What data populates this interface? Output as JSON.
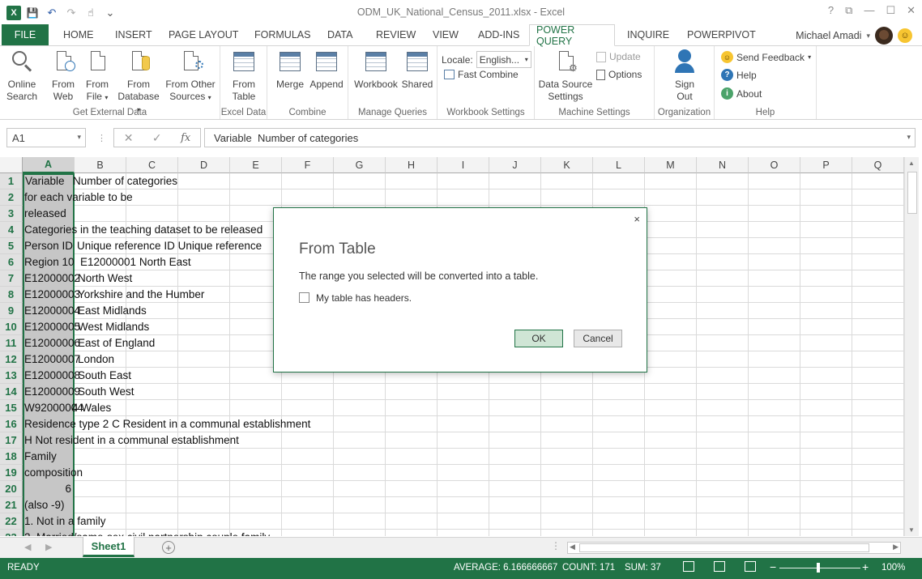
{
  "window": {
    "title": "ODM_UK_National_Census_2011.xlsx - Excel",
    "help_glyph": "?",
    "restore_glyph": "⧉",
    "minimize_glyph": "—",
    "maximize_glyph": "☐",
    "close_glyph": "✕"
  },
  "qat": {
    "logo": "X",
    "save_glyph": "💾",
    "undo_glyph": "↶",
    "redo_glyph": "↷",
    "touch_glyph": "☝",
    "more_glyph": "⌄"
  },
  "tabs": {
    "file": "FILE",
    "items": [
      "HOME",
      "INSERT",
      "PAGE LAYOUT",
      "FORMULAS",
      "DATA",
      "REVIEW",
      "VIEW",
      "ADD-INS",
      "POWER QUERY",
      "INQUIRE",
      "POWERPIVOT"
    ],
    "active": "POWER QUERY"
  },
  "user": {
    "name": "Michael Amadi",
    "dropdown": "▾",
    "smiley": "☺"
  },
  "ribbon": {
    "get_external_data": {
      "label": "Get External Data",
      "online_search": [
        "Online",
        "Search"
      ],
      "from_web": [
        "From",
        "Web"
      ],
      "from_file": [
        "From",
        "File"
      ],
      "from_database": [
        "From",
        "Database"
      ],
      "from_other": [
        "From Other",
        "Sources"
      ]
    },
    "excel_data": {
      "label": "Excel Data",
      "from_table": [
        "From",
        "Table"
      ]
    },
    "combine": {
      "label": "Combine",
      "merge": "Merge",
      "append": "Append"
    },
    "manage_queries": {
      "label": "Manage Queries",
      "workbook": "Workbook",
      "shared": "Shared"
    },
    "workbook_settings": {
      "label": "Workbook Settings",
      "locale_label": "Locale:",
      "locale_value": "English...",
      "fast_combine": "Fast Combine"
    },
    "machine_settings": {
      "label": "Machine Settings",
      "data_source": [
        "Data Source",
        "Settings"
      ],
      "update": "Update",
      "options": "Options"
    },
    "organization": {
      "label": "Organization",
      "sign_out": [
        "Sign",
        "Out"
      ]
    },
    "help": {
      "label": "Help",
      "send_feedback": "Send Feedback",
      "help": "Help",
      "about": "About"
    }
  },
  "formula_bar": {
    "name_box": "A1",
    "cancel_glyph": "✕",
    "enter_glyph": "✓",
    "fx": "fx",
    "value": "Variable  Number of categories"
  },
  "columns": [
    "A",
    "B",
    "C",
    "D",
    "E",
    "F",
    "G",
    "H",
    "I",
    "J",
    "K",
    "L",
    "M",
    "N",
    "O",
    "P",
    "Q"
  ],
  "rows": [
    "1",
    "2",
    "3",
    "4",
    "5",
    "6",
    "7",
    "8",
    "9",
    "10",
    "11",
    "12",
    "13",
    "14",
    "15",
    "16",
    "17",
    "18",
    "19",
    "20",
    "21",
    "22",
    "23"
  ],
  "cells": {
    "r1a": "Variable",
    "r1b": "Number of categories",
    "r2": "for each variable to be",
    "r3": "released",
    "r4": "Categories in the teaching dataset to be released",
    "r5a": "Person ID",
    "r5b": "Unique reference ID  Unique reference",
    "r6a": "Region  10",
    "r6b": "E12000001 North East",
    "r7a": "E12000002",
    "r7b": "North West",
    "r8a": "E12000003",
    "r8b": "Yorkshire and the Humber",
    "r9a": "E12000004",
    "r9b": "East Midlands",
    "r10a": "E12000005",
    "r10b": "West Midlands",
    "r11a": "E12000006",
    "r11b": "East of England",
    "r12a": "E12000007",
    "r12b": "London",
    "r13a": "E12000008",
    "r13b": "South East",
    "r14a": "E12000009",
    "r14b": "South West",
    "r15a": "W92000004",
    "r15b": "4 Wales",
    "r16": "Residence type  2  C Resident in a communal establishment",
    "r17": "H Not resident in a communal establishment",
    "r18": "Family",
    "r19": "composition",
    "r20": "6",
    "r21": "(also -9)",
    "r22": "1. Not in a family",
    "r23": "2. Married/same-sex civil partnership couple family"
  },
  "sheet": {
    "tab": "Sheet1",
    "add_glyph": "+",
    "prev_glyph": "◀",
    "next_glyph": "▶"
  },
  "status": {
    "ready": "READY",
    "average": "AVERAGE: 6.166666667",
    "count": "COUNT: 171",
    "sum": "SUM: 37",
    "zoom": "100%",
    "zoom_out": "−",
    "zoom_in": "+"
  },
  "dialog": {
    "title": "From Table",
    "message": "The range you selected will be converted into a table.",
    "checkbox_label": "My table has headers.",
    "checkbox_checked": false,
    "ok": "OK",
    "cancel": "Cancel",
    "close_glyph": "×"
  },
  "colors": {
    "excel_green": "#217346",
    "selection_gray": "#c6c6c6"
  }
}
